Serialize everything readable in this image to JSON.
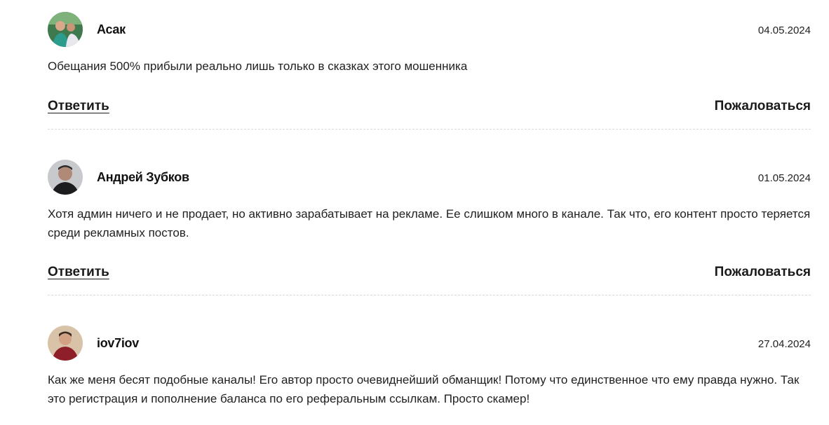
{
  "comments": [
    {
      "author": "Асак",
      "date": "04.05.2024",
      "text": "Обещания 500% прибыли реально лишь только в сказках этого мошенника",
      "reply_label": "Ответить",
      "report_label": "Пожаловаться",
      "avatar_icon": "user-photo-icon"
    },
    {
      "author": "Андрей Зубков",
      "date": "01.05.2024",
      "text": "Хотя админ ничего и не продает, но активно зарабатывает на рекламе. Ее слишком много в канале. Так что, его контент просто теряется среди рекламных постов.",
      "reply_label": "Ответить",
      "report_label": "Пожаловаться",
      "avatar_icon": "user-photo-icon"
    },
    {
      "author": "iov7iov",
      "date": "27.04.2024",
      "text": "Как же меня бесят подобные каналы! Его автор просто очевиднейший обманщик! Потому что единственное что ему правда нужно. Так это регистрация и пополнение баланса по его реферальным ссылкам. Просто скамер!",
      "avatar_icon": "user-photo-icon"
    }
  ],
  "colors": {
    "text": "#1a1a1a",
    "divider": "#d9d9d9",
    "background": "#ffffff"
  }
}
